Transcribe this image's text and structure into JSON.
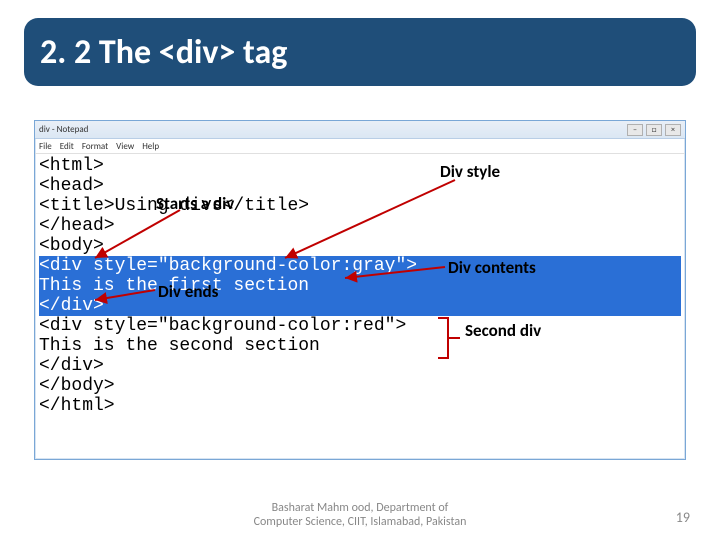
{
  "title": "2. 2 The <div> tag",
  "notepad": {
    "caption": "div - Notepad",
    "menu": [
      "File",
      "Edit",
      "Format",
      "View",
      "Help"
    ],
    "code_lines": [
      "<html>",
      "<head>",
      "<title>Using divs</title>",
      "</head>",
      "<body>",
      "<div style=\"background-color:gray\">",
      "This is the first section",
      "</div>",
      "<div style=\"background-color:red\">",
      "This is the second section",
      "</div>",
      "</body>",
      "</html>"
    ],
    "selected_line_indices": [
      5,
      6,
      7
    ]
  },
  "annotations": {
    "starts_a_div": "Starts a div",
    "div_style": "Div style",
    "div_ends": "Div ends",
    "div_contents": "Div contents",
    "second_div": "Second div"
  },
  "footer": {
    "credit_line1": "Basharat Mahm ood, Department of",
    "credit_line2": "Computer Science, CIIT, Islamabad, Pakistan",
    "page_number": "19"
  }
}
